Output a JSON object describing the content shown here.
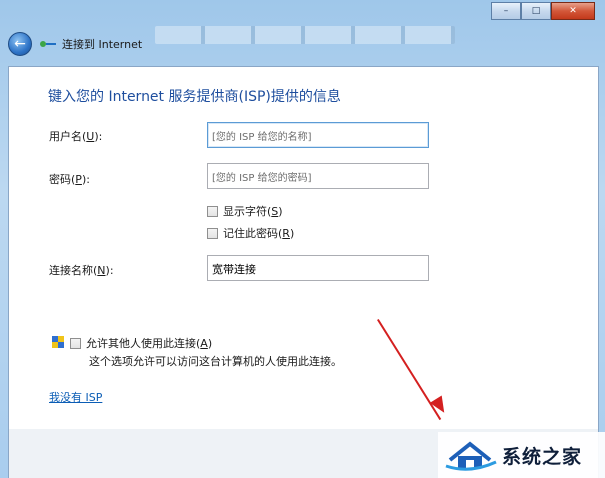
{
  "window": {
    "nav_title": "连接到 Internet",
    "minimize": "–",
    "maximize": "□",
    "close": "✕"
  },
  "form": {
    "heading": "键入您的 Internet 服务提供商(ISP)提供的信息",
    "username": {
      "label_prefix": "用户名(",
      "key": "U",
      "label_suffix": "):",
      "placeholder": "[您的 ISP 给您的名称]"
    },
    "password": {
      "label_prefix": "密码(",
      "key": "P",
      "label_suffix": "):",
      "placeholder": "[您的 ISP 给您的密码]"
    },
    "show_chars": {
      "label_prefix": "显示字符(",
      "key": "S",
      "label_suffix": ")"
    },
    "remember": {
      "label_prefix": "记住此密码(",
      "key": "R",
      "label_suffix": ")"
    },
    "conn_name": {
      "label_prefix": "连接名称(",
      "key": "N",
      "label_suffix": "):",
      "value": "宽带连接"
    },
    "allow_others": {
      "label_prefix": "允许其他人使用此连接(",
      "key": "A",
      "label_suffix": ")"
    },
    "allow_note": "这个选项允许可以访问这台计算机的人使用此连接。",
    "no_isp_link": "我没有 ISP"
  },
  "watermark": {
    "text": "系统之家"
  },
  "colors": {
    "heading": "#1e4e9e",
    "link": "#0b5db5",
    "arrow": "#d42020"
  }
}
